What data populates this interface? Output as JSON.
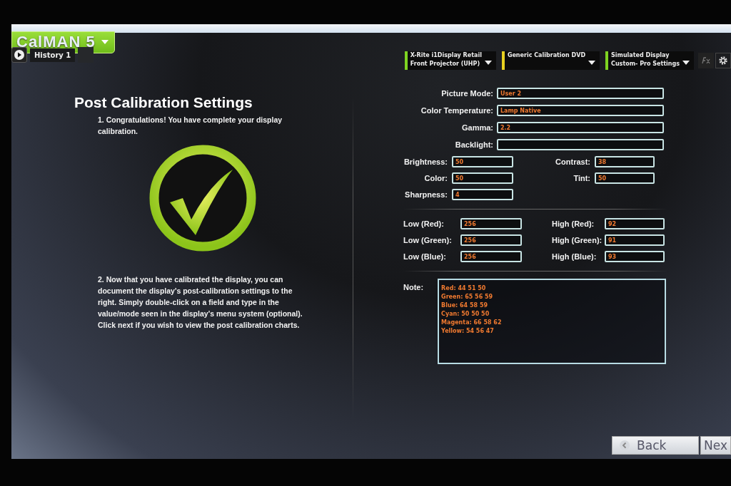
{
  "app": {
    "logo": "CalMAN 5"
  },
  "tabs": [
    {
      "label": "History 1",
      "selected": true
    }
  ],
  "devices": [
    {
      "line1": "X-Rite i1Display Retail",
      "line2": "Front Projector (UHP)",
      "color": "#7ed321"
    },
    {
      "line1": "Generic Calibration DVD",
      "color": "#e8d020"
    },
    {
      "line1": "Simulated Display",
      "line2": "Custom- Pro Settings",
      "color": "#7ed321"
    }
  ],
  "page": {
    "title": "Post Calibration Settings",
    "steps": [
      "1.  Congratulations! You have complete your display calibration.",
      "2.  Now that you have calibrated the display, you can document the display's post-calibration settings to the right. Simply double-click on a field and type in the value/mode seen in the display's menu system (optional). Click next if you wish to view the post calibration charts."
    ]
  },
  "settings": {
    "wide": [
      {
        "label": "Picture Mode:",
        "value": "User 2"
      },
      {
        "label": "Color Temperature:",
        "value": "Lamp Native"
      },
      {
        "label": "Gamma:",
        "value": "2.2"
      },
      {
        "label": "Backlight:"
      }
    ],
    "pairs": [
      [
        {
          "label": "Brightness:",
          "value": "50"
        },
        {
          "label": "Contrast:",
          "value": "38"
        }
      ],
      [
        {
          "label": "Color:",
          "value": "50"
        },
        {
          "label": "Tint:",
          "value": "50"
        }
      ],
      [
        {
          "label": "Sharpness:",
          "value": "4"
        }
      ]
    ],
    "levels": [
      [
        {
          "label": "Low (Red):",
          "value": "256"
        },
        {
          "label": "High (Red):",
          "value": "92"
        }
      ],
      [
        {
          "label": "Low (Green):",
          "value": "256"
        },
        {
          "label": "High (Green):",
          "value": "91"
        }
      ],
      [
        {
          "label": "Low (Blue):",
          "value": "256"
        },
        {
          "label": "High (Blue):",
          "value": "93"
        }
      ]
    ],
    "note": {
      "label": "Note:",
      "lines": [
        "Red: 44 51 50",
        "Green: 65 56 59",
        "Blue: 64 58 59",
        "Cyan: 50 50 50",
        "Magenta: 66 58 62",
        "Yellow: 54 56 47"
      ]
    }
  },
  "nav": {
    "back": "Back",
    "next": "Nex"
  }
}
